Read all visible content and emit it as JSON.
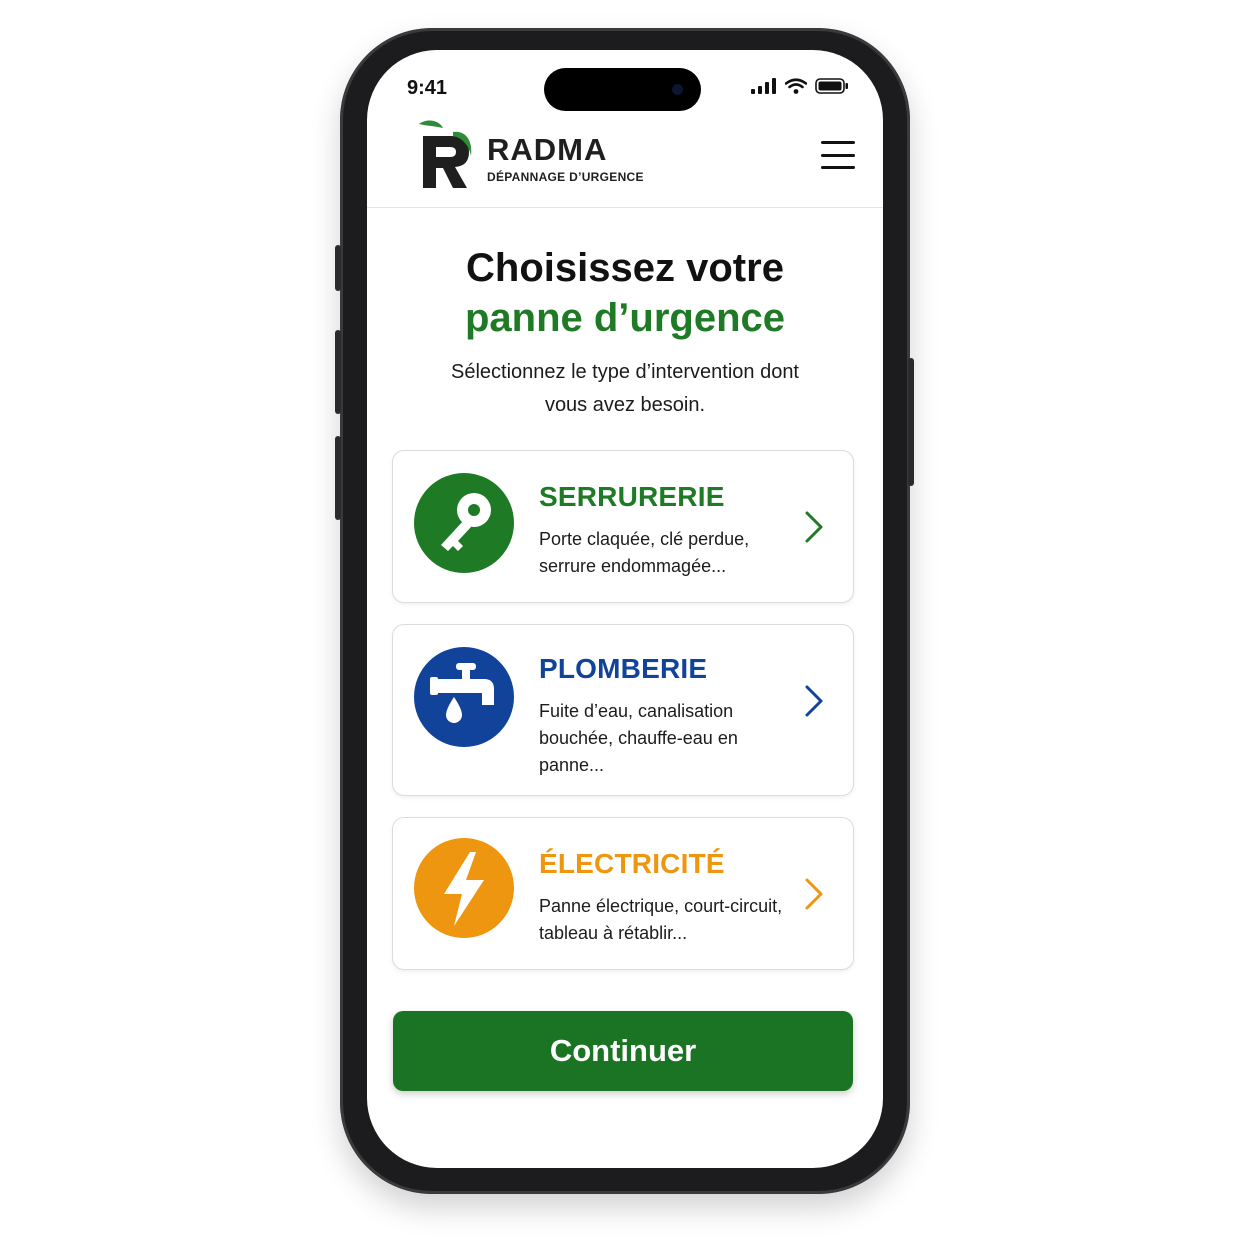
{
  "status_bar": {
    "time": "9:41"
  },
  "header": {
    "brand_name": "RADMA",
    "brand_subtitle": "DÉPANNAGE D’URGENCE",
    "logo_icon": "radma-logo",
    "menu_icon": "hamburger-menu-icon"
  },
  "main": {
    "title_line1": "Choisissez votre",
    "title_line2": "panne d’urgence",
    "subtitle": "Sélectionnez le type d’intervention dont vous avez besoin.",
    "services": [
      {
        "title": "SERRURERIE",
        "description": "Porte claquée, clé perdue, serrure endommagée...",
        "icon": "key-icon",
        "color": "#1e7a24"
      },
      {
        "title": "PLOMBERIE",
        "description": "Fuite d’eau, canalisation bouchée, chauffe-eau en panne...",
        "icon": "faucet-icon",
        "color": "#12439b"
      },
      {
        "title": "ÉLECTRICITÉ",
        "description": "Panne électrique, court-circuit, tableau à rétablir...",
        "icon": "lightning-icon",
        "color": "#ee9610"
      }
    ],
    "continue_label": "Continuer"
  },
  "colors": {
    "primary_green": "#1b7424",
    "blue": "#12439b",
    "orange": "#ee9610"
  }
}
